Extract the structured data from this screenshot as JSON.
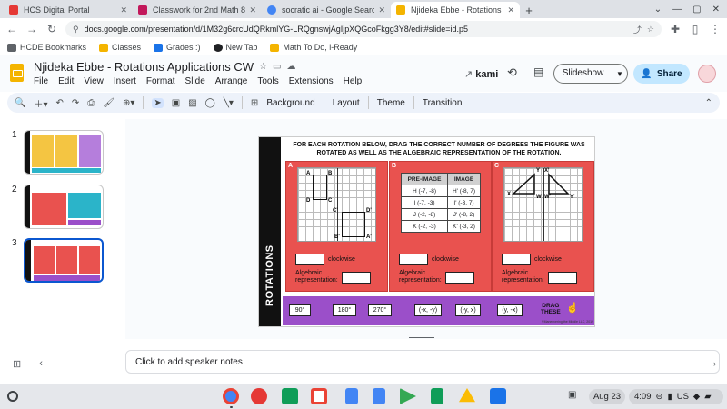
{
  "browser": {
    "tabs": [
      {
        "title": "HCS Digital Portal",
        "color": "#e53935",
        "active": false
      },
      {
        "title": "Classwork for 2nd Math 8",
        "color": "#c2185b",
        "active": false
      },
      {
        "title": "socratic ai - Google Search",
        "color": "#4285f4",
        "active": false
      },
      {
        "title": "Njideka Ebbe - Rotations Applicat",
        "color": "#f4b400",
        "active": true
      }
    ],
    "new_tab_glyph": "+",
    "url": "docs.google.com/presentation/d/1M32g6crcUdQRkmlYG-LRQgnswjAgIjpXQGcoFkgg3Y8/edit#slide=id.p5",
    "bookmarks": [
      {
        "label": "HCDE Bookmarks",
        "color": "#5f6368"
      },
      {
        "label": "Classes",
        "color": "#f4b400"
      },
      {
        "label": "Grades :)",
        "color": "#1a73e8"
      },
      {
        "label": "New Tab",
        "color": "#202124"
      },
      {
        "label": "Math To Do, i-Ready",
        "color": "#f4b400"
      }
    ]
  },
  "app": {
    "title": "Njideka Ebbe - Rotations Applications CW",
    "menus": [
      "File",
      "Edit",
      "View",
      "Insert",
      "Format",
      "Slide",
      "Arrange",
      "Tools",
      "Extensions",
      "Help"
    ],
    "kami_label": "kami",
    "slideshow_label": "Slideshow",
    "share_label": "Share",
    "toolbar": {
      "background": "Background",
      "layout": "Layout",
      "theme": "Theme",
      "transition": "Transition"
    }
  },
  "filmstrip": {
    "numbers": [
      "1",
      "2",
      "3"
    ],
    "selected": 3
  },
  "slide": {
    "side_title": "ROTATIONS",
    "instructions_line1": "FOR EACH ROTATION BELOW, DRAG THE CORRECT NUMBER OF DEGREES THE FIGURE WAS",
    "instructions_line2": "ROTATED AS WELL AS THE ALGEBRAIC REPRESENTATION OF THE ROTATION.",
    "panels": [
      {
        "label": "A",
        "rotation_text": "clockwise",
        "alg_line1": "Algebraic",
        "alg_line2": "representation:"
      },
      {
        "label": "B",
        "rotation_text": "clockwise",
        "alg_line1": "Algebraic",
        "alg_line2": "representation:"
      },
      {
        "label": "C",
        "rotation_text": "clockwise",
        "alg_line1": "Algebraic",
        "alg_line2": "representation:"
      }
    ],
    "panel_a_vertices": [
      "A",
      "B",
      "D",
      "C",
      "C'",
      "D'",
      "B'",
      "A'"
    ],
    "panel_c_vertices": [
      "X",
      "Y",
      "W",
      "Y'",
      "X'",
      "W'"
    ],
    "table": {
      "headers": [
        "PRE-IMAGE",
        "IMAGE"
      ],
      "rows": [
        [
          "H (-7, -8)",
          "H' (-8, 7)"
        ],
        [
          "I (-7, -3)",
          "I' (-3, 7)"
        ],
        [
          "J (-2, -8)",
          "J' (-8, 2)"
        ],
        [
          "K (-2, -3)",
          "K' (-3, 2)"
        ]
      ]
    },
    "chips": [
      "90°",
      "180°",
      "270°",
      "(-x, -y)",
      "(-y, x)",
      "(y, -x)"
    ],
    "drag_line1": "DRAG",
    "drag_line2": "THESE",
    "copyright": "©Maneuvering the Middle LLC, 2019"
  },
  "notes_placeholder": "Click to add speaker notes",
  "shelf": {
    "apps": [
      {
        "name": "chrome",
        "color": "#4285f4"
      },
      {
        "name": "paint",
        "color": "#e53935"
      },
      {
        "name": "classroom",
        "color": "#0f9d58"
      },
      {
        "name": "gmail",
        "color": "#ea4335"
      },
      {
        "name": "docs",
        "color": "#4285f4"
      },
      {
        "name": "play",
        "color": "#34a853"
      },
      {
        "name": "sheets",
        "color": "#0f9d58"
      },
      {
        "name": "drive",
        "color": "#fbbc04"
      },
      {
        "name": "files",
        "color": "#1a73e8"
      }
    ],
    "date": "Aug 23",
    "time": "4:09",
    "locale": "US"
  }
}
